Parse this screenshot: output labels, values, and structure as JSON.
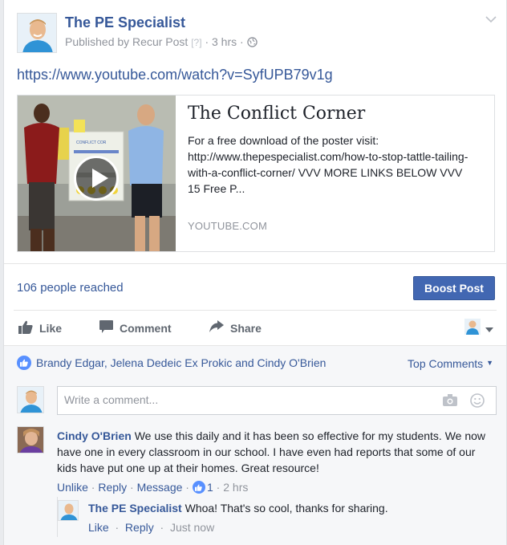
{
  "post": {
    "page_name": "The PE Specialist",
    "published_by": "Published by Recur Post",
    "help_mark": "[?]",
    "time": "3 hrs",
    "link_url": "https://www.youtube.com/watch?v=SyfUPB79v1g"
  },
  "share": {
    "title": "The Conflict Corner",
    "description": "For a free download of the poster visit: http://www.thepespecialist.com/how-to-stop-tattle-tailing-with-a-conflict-corner/ VVV MORE LINKS BELOW VVV 15 Free P...",
    "domain": "YOUTUBE.COM",
    "poster_text": "CONFLICT COR"
  },
  "stats": {
    "reach": "106 people reached",
    "boost_label": "Boost Post"
  },
  "actions": {
    "like": "Like",
    "comment": "Comment",
    "share": "Share"
  },
  "reactions": {
    "names": "Brandy Edgar, Jelena Dedeic Ex Prokic and Cindy O'Brien",
    "top_comments": "Top Comments"
  },
  "composer": {
    "placeholder": "Write a comment..."
  },
  "comment": {
    "author": "Cindy O'Brien",
    "text": "We use this daily and it has been so effective for my students. We now have one in every classroom in our school. I have even had reports that some of our kids have put one up at their homes. Great resource!",
    "unlike": "Unlike",
    "reply": "Reply",
    "message": "Message",
    "like_count": "1",
    "time": "2 hrs"
  },
  "reply": {
    "author": "The PE Specialist",
    "text": "Whoa! That's so cool, thanks for sharing.",
    "like": "Like",
    "reply": "Reply",
    "time": "Just now"
  },
  "colors": {
    "link_blue": "#365899",
    "boost_blue": "#4267b2",
    "like_blue": "#5890ff",
    "muted_gray": "#90949c"
  }
}
